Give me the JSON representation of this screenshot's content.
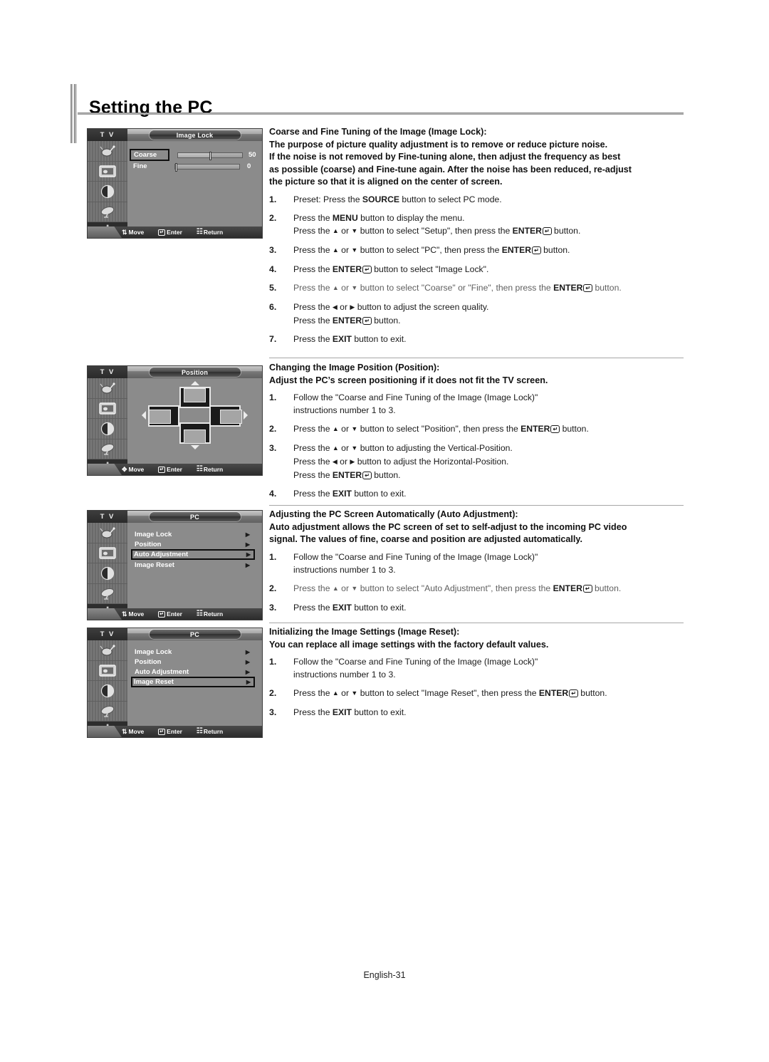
{
  "page": {
    "title": "Setting the PC",
    "footer": "English-31"
  },
  "osd_common": {
    "tv_label": "T V",
    "bottom_bar": [
      {
        "icon": "up-down-arrows-icon",
        "label": "Move"
      },
      {
        "icon": "enter-icon",
        "label": "Enter"
      },
      {
        "icon": "return-icon",
        "label": "Return"
      }
    ],
    "bottom_bar_move_pad": {
      "icon": "four-way-arrows-icon",
      "label": "Move"
    },
    "sidebar_icons": [
      "input-source-icon",
      "picture-icon",
      "sound-icon",
      "channel-dish-icon",
      "setup-gear-icon"
    ]
  },
  "osd_panels": [
    {
      "id": "image-lock",
      "title": "Image Lock",
      "rows": [
        {
          "label": "Coarse",
          "value": "50",
          "percent": 50,
          "selected": true
        },
        {
          "label": "Fine",
          "value": "0",
          "percent": 0,
          "selected": false
        }
      ]
    },
    {
      "id": "position",
      "title": "Position",
      "graphic": "position-four-way-diagram"
    },
    {
      "id": "pc-auto-adjustment",
      "title": "PC",
      "items": [
        {
          "label": "Image Lock",
          "selected": false
        },
        {
          "label": "Position",
          "selected": false
        },
        {
          "label": "Auto Adjustment",
          "selected": true
        },
        {
          "label": "Image Reset",
          "selected": false
        }
      ]
    },
    {
      "id": "pc-image-reset",
      "title": "PC",
      "items": [
        {
          "label": "Image Lock",
          "selected": false
        },
        {
          "label": "Position",
          "selected": false
        },
        {
          "label": "Auto Adjustment",
          "selected": false
        },
        {
          "label": "Image Reset",
          "selected": true
        }
      ]
    }
  ],
  "sections": {
    "image_lock": {
      "heading": "Coarse and Fine Tuning of the Image (Image Lock):",
      "intro": [
        "The purpose of picture quality adjustment is to remove or reduce picture noise.",
        "If the noise is not removed by Fine-tuning alone, then adjust the frequency as best",
        "as possible (coarse) and Fine-tune again. After the noise has been reduced, re-adjust",
        "the picture so that it is aligned on the center of screen."
      ],
      "steps": [
        {
          "num": "1.",
          "lines": [
            "Preset: Press the SOURCE button to select PC mode."
          ]
        },
        {
          "num": "2.",
          "lines": [
            "Press the MENU button to display the menu.",
            "Press the ▲ or ▼ button to select \"Setup\", then press the ENTER button."
          ]
        },
        {
          "num": "3.",
          "lines": [
            "Press the ▲ or ▼ button to select \"PC\", then press the ENTER button."
          ]
        },
        {
          "num": "4.",
          "lines": [
            "Press the ENTER button to select \"Image Lock\"."
          ]
        },
        {
          "num": "5.",
          "lines": [
            "Press the ▲ or ▼ button to select \"Coarse\" or \"Fine\", then press the ENTER button."
          ]
        },
        {
          "num": "6.",
          "lines": [
            "Press the ◄ or ► button to adjust the screen quality.",
            "Press the ENTER button."
          ]
        },
        {
          "num": "7.",
          "lines": [
            "Press the EXIT button to exit."
          ]
        }
      ]
    },
    "position": {
      "heading": "Changing the Image Position (Position):",
      "intro": [
        "Adjust the PC’s screen positioning if it does not fit the TV screen."
      ],
      "steps": [
        {
          "num": "1.",
          "lines": [
            "Follow the \"Coarse and Fine Tuning of the Image (Image Lock)\"",
            "instructions number 1 to 3."
          ]
        },
        {
          "num": "2.",
          "lines": [
            "Press the ▲ or ▼ button to select \"Position\", then press the ENTER button."
          ]
        },
        {
          "num": "3.",
          "lines": [
            "Press the ▲ or ▼ button to adjusting the Vertical-Position.",
            "Press the ◄ or ► button to adjust the Horizontal-Position.",
            "Press the ENTER button."
          ]
        },
        {
          "num": "4.",
          "lines": [
            "Press the EXIT button to exit."
          ]
        }
      ]
    },
    "auto_adjustment": {
      "heading": "Adjusting the PC Screen Automatically (Auto Adjustment):",
      "intro": [
        "Auto adjustment allows the PC screen of set to self-adjust to the incoming PC video",
        "signal. The values of fine, coarse and position are adjusted automatically."
      ],
      "steps": [
        {
          "num": "1.",
          "lines": [
            "Follow the \"Coarse and Fine Tuning of the Image (Image Lock)\"",
            "instructions number 1 to 3."
          ]
        },
        {
          "num": "2.",
          "lines": [
            "Press the ▲ or ▼ button to select \"Auto Adjustment\", then press the ENTER button."
          ]
        },
        {
          "num": "3.",
          "lines": [
            "Press the EXIT button to exit."
          ]
        }
      ]
    },
    "image_reset": {
      "heading": "Initializing the Image Settings (Image Reset):",
      "intro": [
        "You can replace all image settings with the factory default values."
      ],
      "steps": [
        {
          "num": "1.",
          "lines": [
            "Follow the \"Coarse and Fine Tuning of the Image (Image Lock)\"",
            "instructions number 1 to 3."
          ]
        },
        {
          "num": "2.",
          "lines": [
            "Press the ▲ or ▼ button to select \"Image Reset\", then press the ENTER button."
          ]
        },
        {
          "num": "3.",
          "lines": [
            "Press the EXIT button to exit."
          ]
        }
      ]
    }
  },
  "colors": {
    "osd_background": "#8b8b8b",
    "osd_dark": "#2c2c2c",
    "text": "#1a1a1a",
    "rule": "#9a9a9a"
  }
}
